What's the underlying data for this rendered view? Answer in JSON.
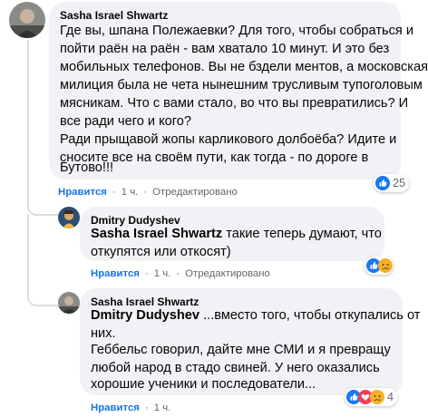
{
  "comments": [
    {
      "author": "Sasha Israel Shwartz",
      "lines": [
        "Где вы, шпана Полежаевки? Для того, чтобы собраться и",
        "пойти раён на раён - вам хватало 10 минут. И это без",
        "мобильных телефонов. Вы не бздели ментов, а московская",
        "милиция была не чета нынешним трусливым тупоголовым",
        "мясникам. Что с вами стало, во что вы превратились? И",
        "все ради чего и кого?",
        "Ради прыщавой жопы карликового долбоёба? Идите и",
        "сносите все на своём пути, как тогда - по дороге в",
        "Бутово!!!"
      ],
      "like_label": "Нравится",
      "time": "1 ч.",
      "edited": "Отредактировано",
      "reaction_count": "25"
    },
    {
      "author": "Dmitry Dudyshev",
      "mention": "Sasha Israel Shwartz",
      "lines": [
        " такие теперь думают, что",
        "откупятся или откосят)"
      ],
      "like_label": "Нравится",
      "time": "1 ч.",
      "edited": "Отредактировано",
      "reaction_count": ""
    },
    {
      "author": "Sasha Israel Shwartz",
      "mention": "Dmitry Dudyshev",
      "lines": [
        " ...вместо того, чтобы откупались от",
        "них.",
        "Геббельс говорил, дайте мне СМИ и я превращу",
        "любой народ в стадо свиней. У него оказались",
        "хорошие ученики и последователи..."
      ],
      "like_label": "Нравится",
      "time": "1 ч.",
      "edited": "",
      "reaction_count": "4"
    }
  ],
  "icons": {
    "like": "like-icon",
    "sad": "sad-icon",
    "love": "love-icon"
  },
  "colors": {
    "bubble": "#f0f2f5",
    "like_blue": "#1b74e4",
    "meta_gray": "#65676b"
  }
}
